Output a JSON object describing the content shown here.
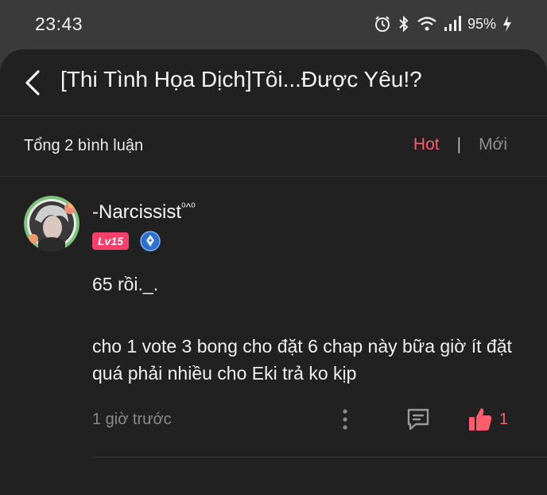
{
  "status_bar": {
    "time": "23:43",
    "battery": "95%",
    "icons": [
      "alarm-icon",
      "bluetooth-icon",
      "wifi-icon",
      "signal-icon",
      "charging-icon"
    ]
  },
  "header": {
    "title": "[Thi Tình Họa Dịch]Tôi...Được Yêu!?",
    "back_icon": "chevron-left-icon"
  },
  "comments_bar": {
    "total_label": "Tổng 2 bình luận",
    "sort_hot": "Hot",
    "sort_separator": "|",
    "sort_new": "Mới"
  },
  "comment": {
    "username": "-Narcissist",
    "username_suffix": "⁰^⁰",
    "level": "Lv15",
    "badge_icon": "pen-badge-icon",
    "line1": "65 rồi._.",
    "line2": "cho 1 vote 3 bong cho đặt 6 chap này bữa giờ ít đặt quá phải nhiều cho Eki trả ko kịp",
    "time_ago": "1 giờ trước",
    "like_count": "1"
  },
  "colors": {
    "accent": "#ff5c6c",
    "level_badge": "#ff3f6b",
    "background": "#212121",
    "status_bar": "#3a3a3a"
  }
}
